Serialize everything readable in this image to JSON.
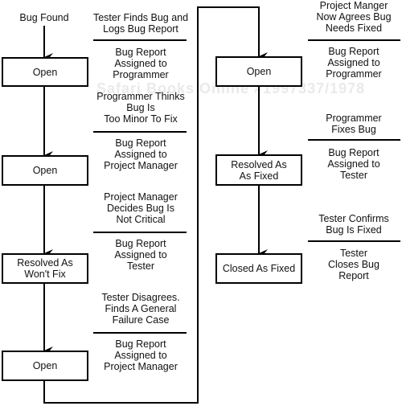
{
  "watermark": "Safari Books Online #1997337/1978",
  "start_label": "Bug Found",
  "left_column": {
    "states": [
      "Open",
      "Open",
      "Resolved As\nWon't Fix",
      "Open"
    ],
    "notes": [
      "Tester Finds Bug and\nLogs Bug Report",
      "Bug Report\nAssigned to\nProgrammer",
      "Programmer Thinks\nBug Is\nToo Minor To Fix",
      "Bug Report\nAssigned to\nProject Manager",
      "Project Manager\nDecides Bug Is\nNot Critical",
      "Bug Report\nAssigned to\nTester",
      "Tester Disagrees.\nFinds A General\nFailure Case",
      "Bug Report\nAssigned to\nProject Manager"
    ]
  },
  "right_column": {
    "states": [
      "Open",
      "Resolved As\nAs Fixed",
      "Closed As Fixed"
    ],
    "notes": [
      "Project Manger\nNow Agrees Bug\nNeeds Fixed",
      "Bug Report\nAssigned to\nProgrammer",
      "Programmer\nFixes Bug",
      "Bug Report\nAssigned to\nTester",
      "Tester Confirms\nBug Is Fixed",
      "Tester\nCloses Bug\nReport"
    ]
  }
}
